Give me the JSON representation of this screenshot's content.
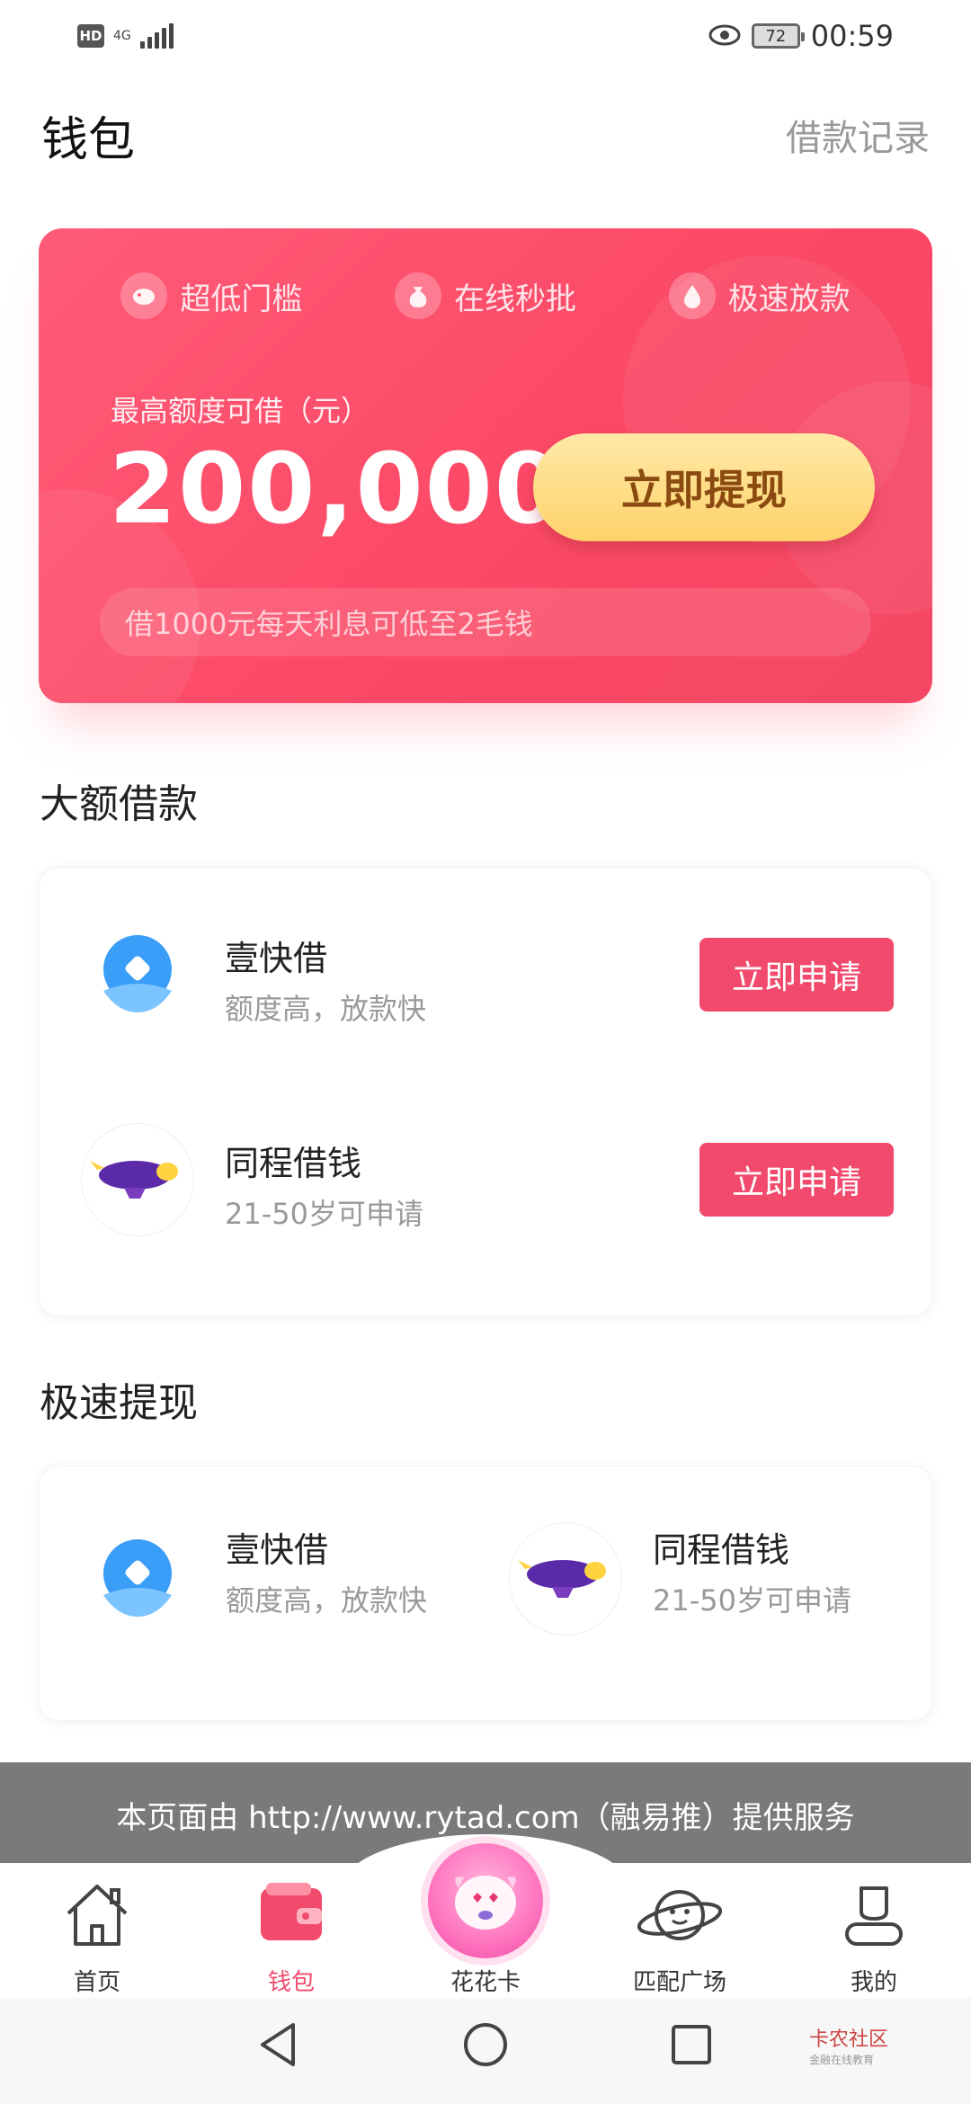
{
  "status_bar": {
    "hd": "HD",
    "network": "4G",
    "battery": "72",
    "time": "00:59"
  },
  "header": {
    "title": "钱包",
    "loan_records": "借款记录"
  },
  "promo": {
    "features": [
      "超低门槛",
      "在线秒批",
      "极速放款"
    ],
    "amount_label": "最高额度可借（元）",
    "amount": "200,000",
    "withdraw_button": "立即提现",
    "interest_note": "借1000元每天利息可低至2毛钱"
  },
  "large_loans": {
    "title": "大额借款",
    "items": [
      {
        "name": "壹快借",
        "desc": "额度高，放款快",
        "button": "立即申请"
      },
      {
        "name": "同程借钱",
        "desc": "21-50岁可申请",
        "button": "立即申请"
      }
    ]
  },
  "fast_withdraw": {
    "title": "极速提现",
    "items": [
      {
        "name": "壹快借",
        "desc": "额度高，放款快"
      },
      {
        "name": "同程借钱",
        "desc": "21-50岁可申请"
      }
    ]
  },
  "service_banner": "本页面由 http://www.rytad.com（融易推）提供服务",
  "tabs": [
    {
      "label": "首页",
      "icon": "home-icon"
    },
    {
      "label": "钱包",
      "icon": "wallet-icon",
      "active": true
    },
    {
      "label": "花花卡",
      "icon": "mascot-icon"
    },
    {
      "label": "匹配广场",
      "icon": "planet-icon"
    },
    {
      "label": "我的",
      "icon": "profile-icon"
    }
  ],
  "watermark": {
    "name": "卡农社区",
    "sub": "金融在线教育"
  },
  "colors": {
    "accent": "#f24a6d",
    "card_gradient_start": "#ff5b77",
    "button_gold": "#ffd26a"
  }
}
